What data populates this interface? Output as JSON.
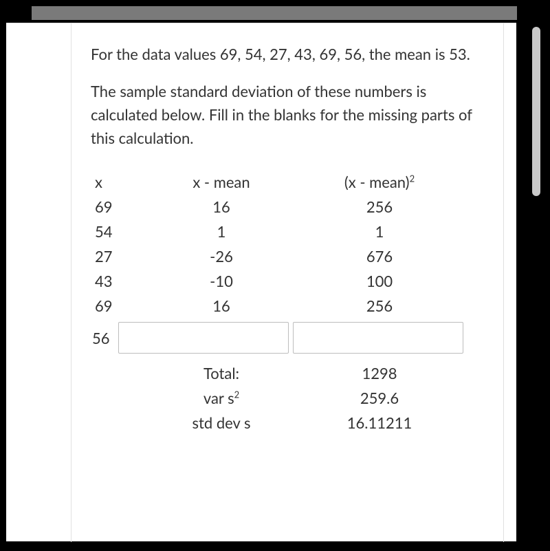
{
  "paragraph1": " For the data values 69, 54, 27, 43, 69, 56, the mean is 53.",
  "paragraph2": "The sample standard deviation of these numbers is calculated below. Fill in the blanks for the missing parts of this calculation.",
  "headers": {
    "x": "x",
    "xmean": "x - mean",
    "xmeansq_prefix": "(x - mean)",
    "sq": "2"
  },
  "rows": [
    {
      "x": "69",
      "m": "16",
      "s": "256"
    },
    {
      "x": "54",
      "m": "1",
      "s": "1"
    },
    {
      "x": "27",
      "m": "-26",
      "s": "676"
    },
    {
      "x": "43",
      "m": "-10",
      "s": "100"
    },
    {
      "x": "69",
      "m": "16",
      "s": "256"
    }
  ],
  "blank_row": {
    "x": "56"
  },
  "footer": {
    "total_label": "Total:",
    "total_val": "1298",
    "var_prefix": "var s",
    "var_sq": "2",
    "var_val": "259.6",
    "std_label": "std dev s",
    "std_val": "16.11211"
  }
}
